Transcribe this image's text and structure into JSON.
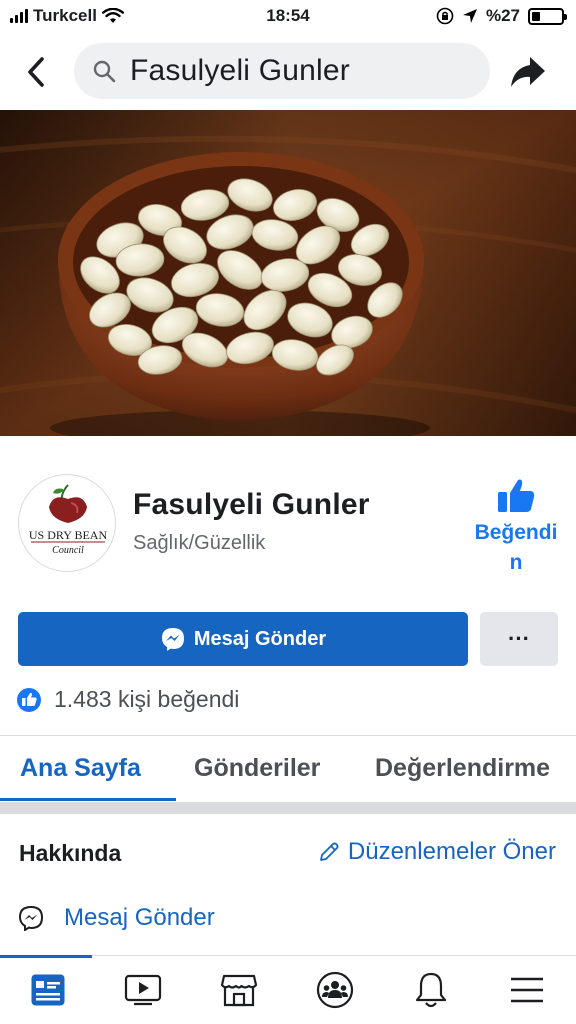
{
  "status_bar": {
    "carrier": "Turkcell",
    "time": "18:54",
    "battery": "%27",
    "battery_level": 0.27
  },
  "header": {
    "search_query": "Fasulyeli Gunler",
    "back_icon": "chevron-left-icon",
    "share_icon": "share-arrow-icon"
  },
  "page": {
    "name": "Fasulyeli Gunler",
    "category": "Sağlık/Güzellik",
    "logo": {
      "line1": "US DRY BEAN",
      "line2": "Council"
    },
    "like_button_label": "Beğendi",
    "like_button_label_wrap": "n"
  },
  "actions": {
    "message_label": "Mesaj Gönder",
    "more_label": "···"
  },
  "likes": {
    "text": "1.483 kişi beğendi"
  },
  "tabs": [
    {
      "label": "Ana Sayfa",
      "active": true
    },
    {
      "label": "Gönderiler",
      "active": false
    },
    {
      "label": "Değerlendirme",
      "active": false
    }
  ],
  "about": {
    "title": "Hakkında",
    "suggest_edits": "Düzenlemeler Öner",
    "message_link": "Mesaj Gönder"
  },
  "bottom_nav": [
    {
      "icon": "news-feed-icon",
      "active": true
    },
    {
      "icon": "watch-video-icon",
      "active": false
    },
    {
      "icon": "marketplace-icon",
      "active": false
    },
    {
      "icon": "groups-icon",
      "active": false
    },
    {
      "icon": "notifications-bell-icon",
      "active": false
    },
    {
      "icon": "menu-icon",
      "active": false
    }
  ],
  "colors": {
    "accent": "#1665c1",
    "link": "#1877f2",
    "text": "#1c1e21",
    "secondary_text": "#65676b"
  }
}
